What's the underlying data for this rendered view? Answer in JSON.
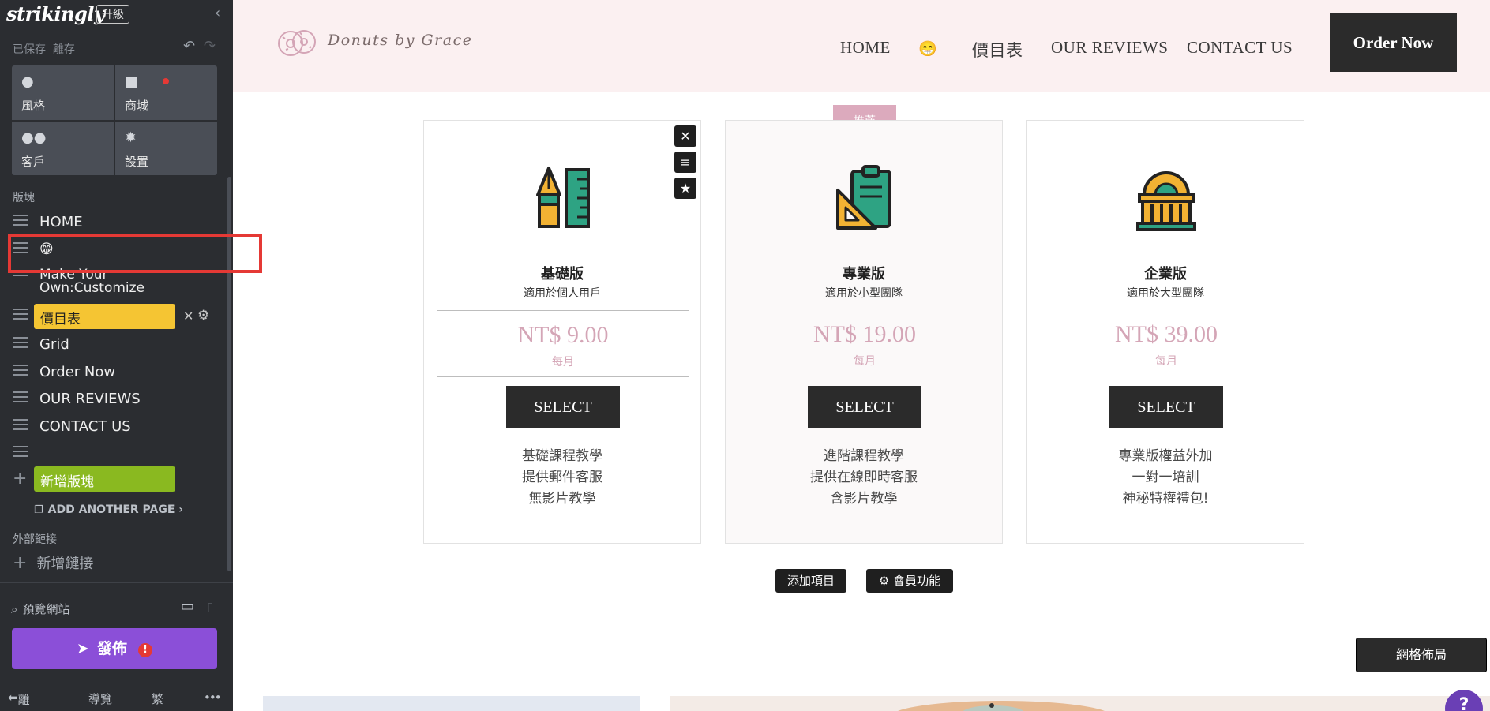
{
  "sidebar": {
    "logo": "strikingly",
    "upgrade": "升級",
    "saved_text": "已保存",
    "saved_link": "離存",
    "tiles": [
      {
        "label": "風格",
        "icon": "palette-icon"
      },
      {
        "label": "商城",
        "icon": "bag-icon"
      },
      {
        "label": "客戶",
        "icon": "users-icon"
      },
      {
        "label": "設置",
        "icon": "gear-icon"
      }
    ],
    "sections_label": "版塊",
    "items": [
      {
        "label": "HOME"
      },
      {
        "label": "😁"
      },
      {
        "label": "Make Your Own:Customize"
      },
      {
        "label": "價目表"
      },
      {
        "label": "Grid"
      },
      {
        "label": "Order Now"
      },
      {
        "label": "OUR REVIEWS"
      },
      {
        "label": "CONTACT US"
      },
      {
        "label": ""
      }
    ],
    "add_section": "新增版塊",
    "add_page": "ADD ANOTHER PAGE",
    "external_links_label": "外部鏈接",
    "add_link": "新增鏈接",
    "preview": "預覽網站",
    "publish": "發佈",
    "footer": {
      "exit": "離開",
      "guide": "導覽",
      "lang": "繁",
      "more": "•••"
    }
  },
  "site": {
    "brand": "Donuts by Grace",
    "nav": [
      "HOME",
      "😁",
      "價目表",
      "OUR REVIEWS",
      "CONTACT US"
    ],
    "order_now": "Order Now"
  },
  "pricing": {
    "recommend_badge": "推薦",
    "plans": [
      {
        "title": "基礎版",
        "subtitle": "適用於個人用戶",
        "price": "NT$ 9.00",
        "period": "每月",
        "button": "SELECT",
        "features": [
          "基礎課程教學",
          "提供郵件客服",
          "無影片教學"
        ],
        "icon": "pen-ruler-icon"
      },
      {
        "title": "專業版",
        "subtitle": "適用於小型團隊",
        "price": "NT$ 19.00",
        "period": "每月",
        "button": "SELECT",
        "features": [
          "進階課程教學",
          "提供在線即時客服",
          "含影片教學"
        ],
        "icon": "clipboard-icon"
      },
      {
        "title": "企業版",
        "subtitle": "適用於大型團隊",
        "price": "NT$ 39.00",
        "period": "每月",
        "button": "SELECT",
        "features": [
          "專業版權益外加",
          "一對一培訓",
          "神秘特權禮包!"
        ],
        "icon": "building-icon"
      }
    ],
    "add_item": "添加項目",
    "member_feature": "會員功能"
  },
  "grid_layout": "網格佈局",
  "colors": {
    "sidebar_bg": "#2b2d31",
    "header_bg": "#fbf0f1",
    "accent_pink": "#d4a5b6",
    "publish": "#8b4fd8",
    "active_section": "#f5c533",
    "add_section": "#8ab920"
  }
}
